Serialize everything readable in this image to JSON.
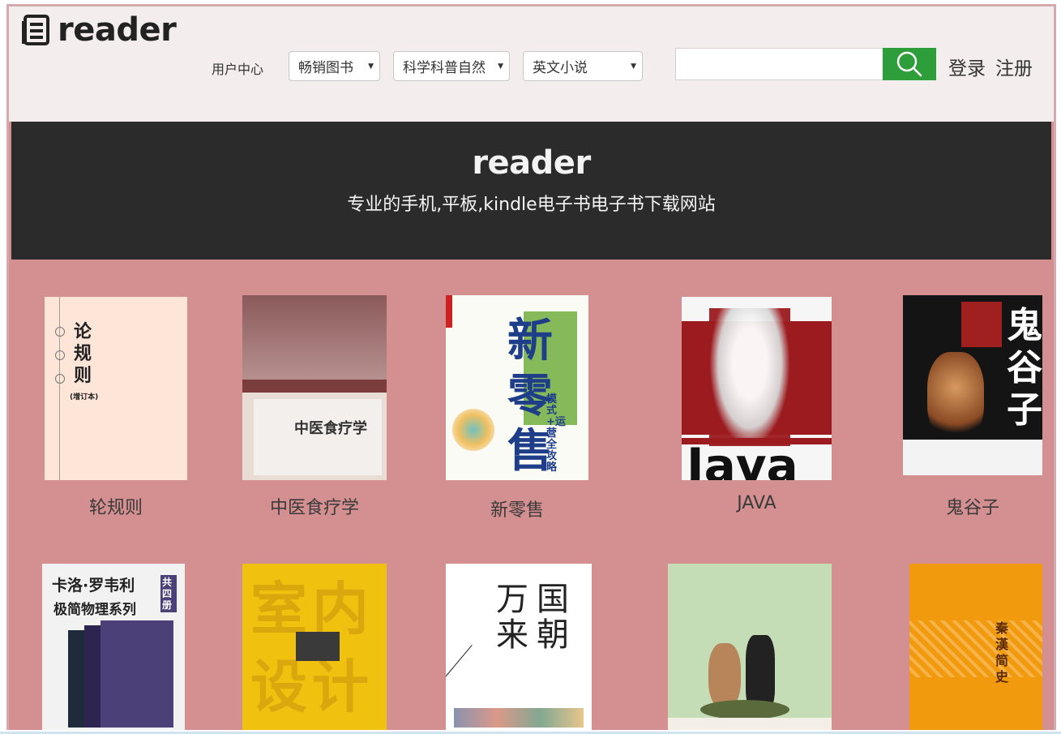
{
  "header": {
    "logo_text": "reader",
    "user_center": "用户中心",
    "selects": [
      {
        "value": "畅销图书"
      },
      {
        "value": "科学科普自然"
      },
      {
        "value": "英文小说"
      }
    ],
    "search": {
      "value": "",
      "placeholder": ""
    },
    "login": "登录",
    "register": "注册"
  },
  "banner": {
    "title": "reader",
    "subtitle": "专业的手机,平板,kindle电子书电子书下载网站"
  },
  "books_row1": [
    {
      "title": "轮规则",
      "cover_text": "论规则",
      "cover_sub": "(增订本)"
    },
    {
      "title": "中医食疗学",
      "cover_text": "中医食疗学"
    },
    {
      "title": "新零售",
      "cover_text": "新零售",
      "cover_sub": "模式+运营全攻略"
    },
    {
      "title": "JAVA",
      "cover_text": "Java"
    },
    {
      "title": "鬼谷子",
      "cover_text": "鬼谷子"
    }
  ],
  "books_row2": [
    {
      "cover_text": "卡洛·罗韦利",
      "cover_sub": "极简物理系列",
      "cover_badge": "共四册"
    },
    {
      "cover_text": "室内设计"
    },
    {
      "cover_text": "万国来朝"
    },
    {
      "cover_text": ""
    },
    {
      "cover_text": "秦漢简史"
    }
  ],
  "colors": {
    "page_bg": "#d48f90",
    "header_bg": "#f3eded",
    "banner_bg": "#2b2b2b",
    "search_button": "#2e9e3b"
  }
}
